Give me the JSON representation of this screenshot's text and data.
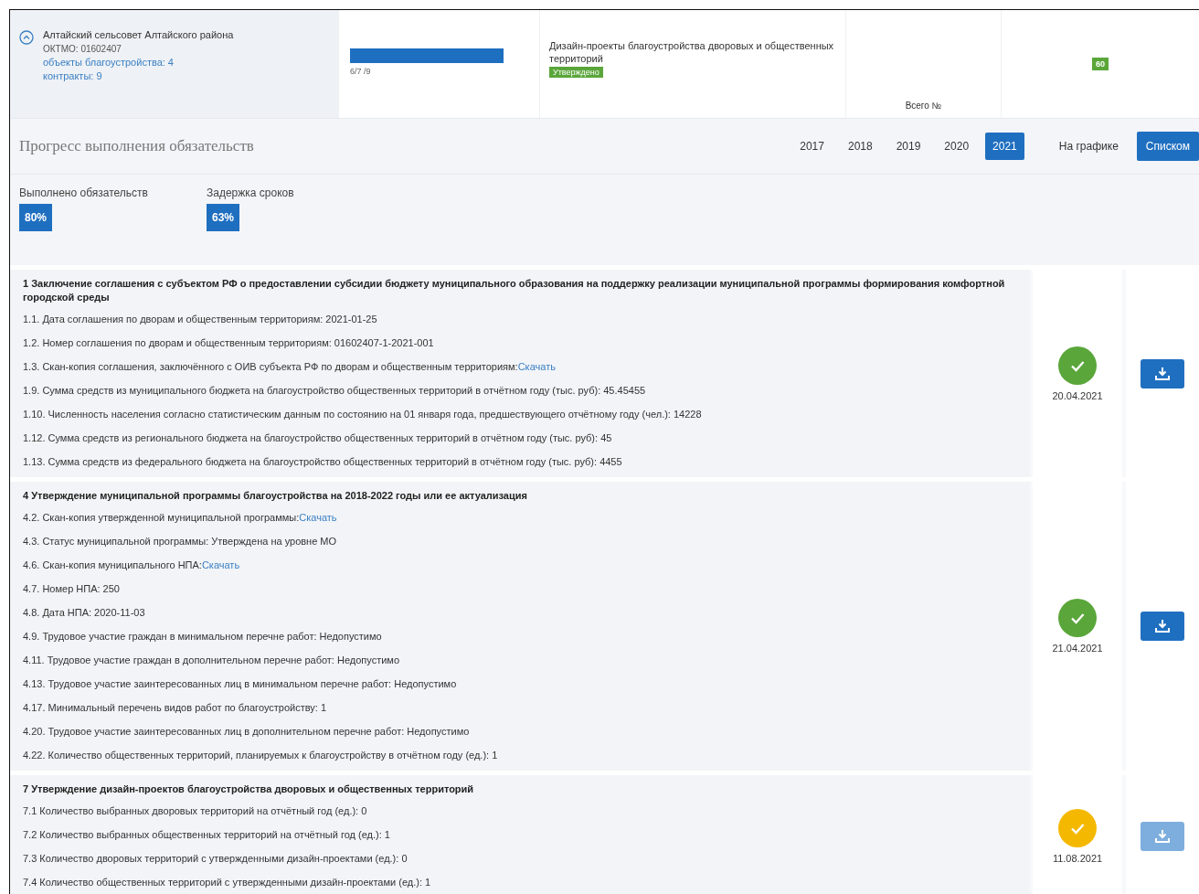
{
  "municipality": {
    "name": "Алтайский сельсовет Алтайского района",
    "oktmo": "ОКТМО: 01602407",
    "objects_link": "объекты благоустройства: 4",
    "contracts_link": "контракты: 9"
  },
  "progress_cell": {
    "level": 1,
    "caption": "6/7 /9"
  },
  "design_cell": {
    "title": "Дизайн-проекты благоустройства дворовых и общественных территорий",
    "tag": "Утверждено"
  },
  "total_cell": {
    "label": "Всего №"
  },
  "badge_cell": {
    "badge": "60"
  },
  "header": {
    "title": "Прогресс выполнения обязательств",
    "years": [
      {
        "label": "2017",
        "selected": false
      },
      {
        "label": "2018",
        "selected": false
      },
      {
        "label": "2019",
        "selected": false
      },
      {
        "label": "2020",
        "selected": false
      },
      {
        "label": "2021",
        "selected": true
      }
    ],
    "views": [
      {
        "label": "На графике",
        "selected": false
      },
      {
        "label": "Списком",
        "selected": true
      }
    ]
  },
  "stats": [
    {
      "label": "Выполнено обязательств",
      "value": "80%"
    },
    {
      "label": "Задержка сроков",
      "value": "63%"
    }
  ],
  "sections": [
    {
      "title": "1 Заключение соглашения с субъектом РФ о предоставлении субсидии бюджету муниципального образования на поддержку реализации муниципальной программы формирования комфортной городской среды",
      "kind": "done",
      "date": "20.04.2021",
      "download_enabled": true,
      "items": [
        {
          "text": "1.1. Дата соглашения по дворам и общественным территориям: 2021-01-25"
        },
        {
          "text": "1.2. Номер соглашения по дворам и общественным территориям: 01602407-1-2021-001"
        },
        {
          "text": "1.3. Скан-копия соглашения, заключённого с ОИВ субъекта РФ по дворам и общественным территориям:",
          "link": "Скачать"
        },
        {
          "text": "1.9. Сумма средств из муниципального бюджета на благоустройство общественных территорий в отчётном году (тыс. руб): 45.45455"
        },
        {
          "text": "1.10. Численность населения согласно статистическим данным по состоянию на 01 января года, предшествующего отчётному году (чел.): 14228"
        },
        {
          "text": "1.12. Сумма средств из регионального бюджета на благоустройство общественных территорий в отчётном году (тыс. руб): 45"
        },
        {
          "text": "1.13. Сумма средств из федерального бюджета на благоустройство общественных территорий в отчётном году (тыс. руб): 4455"
        }
      ]
    },
    {
      "title": "4 Утверждение муниципальной программы благоустройства на 2018-2022 годы или ее актуализация",
      "kind": "done",
      "date": "21.04.2021",
      "download_enabled": true,
      "items": [
        {
          "text": "4.2. Скан-копия утвержденной муниципальной программы:",
          "link": "Скачать"
        },
        {
          "text": "4.3. Статус муниципальной программы: Утверждена на уровне МО"
        },
        {
          "text": "4.6. Скан-копия муниципального НПА:",
          "link": "Скачать"
        },
        {
          "text": "4.7. Номер НПА: 250"
        },
        {
          "text": "4.8. Дата НПА: 2020-11-03"
        },
        {
          "text": "4.9. Трудовое участие граждан в минимальном перечне работ: Недопустимо"
        },
        {
          "text": "4.11. Трудовое участие граждан в дополнительном перечне работ: Недопустимо"
        },
        {
          "text": "4.13. Трудовое участие заинтересованных лиц в минимальном перечне работ: Недопустимо"
        },
        {
          "text": "4.17. Минимальный перечень видов работ по благоустройству: 1"
        },
        {
          "text": "4.20. Трудовое участие заинтересованных лиц в дополнительном перечне работ: Недопустимо"
        },
        {
          "text": "4.22. Количество общественных территорий, планируемых к благоустройству в отчётном году (ед.): 1"
        }
      ]
    },
    {
      "title": "7 Утверждение дизайн-проектов благоустройства дворовых и общественных территорий",
      "kind": "pending",
      "date": "11.08.2021",
      "download_enabled": false,
      "items": [
        {
          "text": "7.1 Количество выбранных дворовых территорий на отчётный год (ед.): 0"
        },
        {
          "text": "7.2 Количество выбранных общественных территорий на отчётный год (ед.): 1"
        },
        {
          "text": "7.3 Количество дворовых территорий с утвержденными дизайн-проектами (ед.): 0"
        },
        {
          "text": "7.4 Количество общественных территорий с утвержденными дизайн-проектами (ед.): 1"
        }
      ]
    }
  ]
}
